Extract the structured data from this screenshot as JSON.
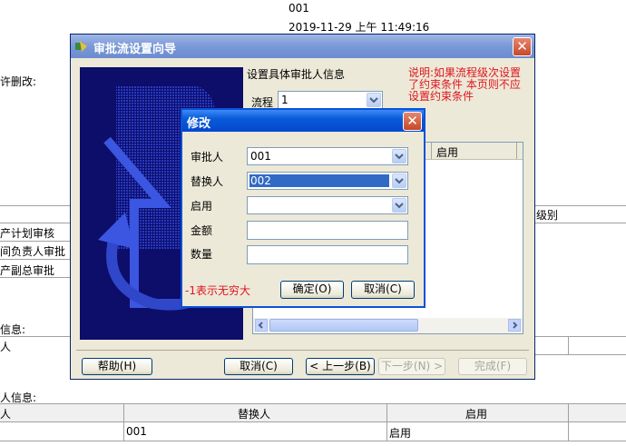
{
  "background": {
    "top_code": "001",
    "timestamp": "2019-11-29 上午  11:49:16",
    "left_label": "许删改:",
    "table1": {
      "header_right": "级别",
      "rows": [
        "产计划审核",
        "间负责人审批",
        "产副总审批"
      ]
    },
    "section_a_label": "信息:",
    "section_a_col": "人",
    "section_b_label": "人信息:",
    "section_b_headers": [
      "人",
      "替换人",
      "启用"
    ],
    "section_b_row": [
      "",
      "001",
      "启用"
    ]
  },
  "wizard": {
    "title": "审批流设置向导",
    "heading": "设置具体审批人信息",
    "note": "说明:如果流程级次设置\n了约束条件 本页则不应\n设置约束条件",
    "flow_label": "流程",
    "flow_value": "1",
    "grid_header": "启用",
    "buttons": {
      "help": "帮助(H)",
      "cancel": "取消(C)",
      "prev": "< 上一步(B)",
      "next": "下一步(N) >",
      "finish": "完成(F)"
    }
  },
  "dialog": {
    "title": "修改",
    "fields": {
      "approver_label": "审批人",
      "approver_value": "001",
      "replacer_label": "替换人",
      "replacer_value": "002",
      "enabled_label": "启用",
      "enabled_value": "",
      "amount_label": "金额",
      "amount_value": "",
      "quantity_label": "数量",
      "quantity_value": ""
    },
    "hint": "-1表示无穷大",
    "ok_label": "确定(O)",
    "cancel_label": "取消(C)"
  },
  "colors": {
    "title_blue": "#0a5bd8",
    "red_note": "#e0141b",
    "selection": "#316ac5"
  }
}
